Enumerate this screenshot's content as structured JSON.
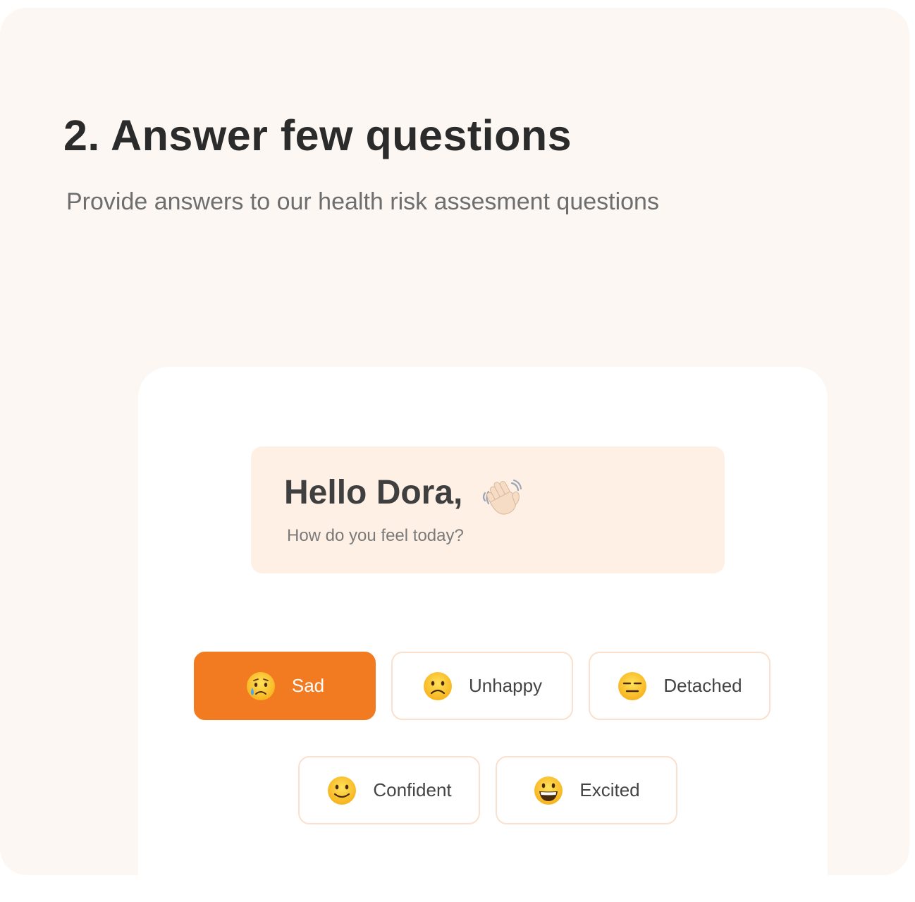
{
  "section": {
    "title": "2. Answer few questions",
    "subtitle": "Provide answers to our health risk assesment questions"
  },
  "greeting": {
    "title": "Hello Dora,",
    "question": "How do you feel today?",
    "icon": "waving-hand-icon"
  },
  "moods": [
    {
      "label": "Sad",
      "icon": "crying-face-icon",
      "selected": true
    },
    {
      "label": "Unhappy",
      "icon": "frowning-face-icon",
      "selected": false
    },
    {
      "label": "Detached",
      "icon": "expressionless-face-icon",
      "selected": false
    },
    {
      "label": "Confident",
      "icon": "slightly-smiling-face-icon",
      "selected": false
    },
    {
      "label": "Excited",
      "icon": "grinning-face-icon",
      "selected": false
    }
  ],
  "colors": {
    "accent": "#f27b22",
    "background": "#fcf7f3",
    "greeting_bg": "#fff0e6",
    "button_border": "#fbe0cd"
  }
}
